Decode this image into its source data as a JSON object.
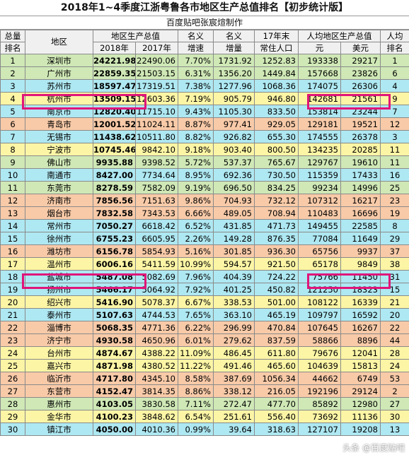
{
  "title": "2018年1~4季度江浙粤鲁各市地区生产总值排名【初步统计版】",
  "subtitle": "百度贴吧张宸煊制作",
  "headers": {
    "rank_line1": "总量",
    "rank_line2": "排名",
    "region": "地区",
    "gdp_group": "地区生产总值",
    "gdp_2018": "2018年",
    "gdp_2017": "2017年",
    "nominal_growth_1": "名义",
    "nominal_growth_2": "增速",
    "nominal_increase_1": "名义",
    "nominal_increase_2": "增量",
    "pop_1": "17年末",
    "pop_2": "常住人口",
    "per_capita_group": "人均地区生产总值",
    "per_capita_yuan": "元",
    "per_capita_usd": "美元",
    "per_capita_rank_1": "人均",
    "per_capita_rank_2": "排名"
  },
  "row_colors": {
    "cyan": "#aee8f2",
    "green": "#cfe8b6",
    "orange": "#f8caa8",
    "yellow": "#fbf5a5"
  },
  "rows": [
    {
      "rank": "1",
      "city": "深圳市",
      "g18": "24221.98",
      "g17": "22490.06",
      "growth": "7.70%",
      "inc": "1731.92",
      "pop": "1252.83",
      "pcy": "193338",
      "pcu": "29217",
      "pcr": "1",
      "color": "green"
    },
    {
      "rank": "2",
      "city": "广州市",
      "g18": "22859.35",
      "g17": "21503.15",
      "growth": "6.31%",
      "inc": "1356.20",
      "pop": "1449.84",
      "pcy": "157668",
      "pcu": "23826",
      "pcr": "6",
      "color": "green"
    },
    {
      "rank": "3",
      "city": "苏州市",
      "g18": "18597.47",
      "g17": "17319.51",
      "growth": "7.38%",
      "inc": "1277.96",
      "pop": "1068.36",
      "pcy": "174075",
      "pcu": "26306",
      "pcr": "4",
      "color": "cyan"
    },
    {
      "rank": "4",
      "city": "杭州市",
      "g18": "13509.15",
      "g17": "12603.36",
      "growth": "7.19%",
      "inc": "905.79",
      "pop": "946.80",
      "pcy": "142681",
      "pcu": "21561",
      "pcr": "9",
      "color": "yellow"
    },
    {
      "rank": "5",
      "city": "南京市",
      "g18": "12820.40",
      "g17": "11715.10",
      "growth": "9.43%",
      "inc": "1105.30",
      "pop": "833.50",
      "pcy": "153814",
      "pcu": "23244",
      "pcr": "7",
      "color": "cyan"
    },
    {
      "rank": "6",
      "city": "青岛市",
      "g18": "12001.52",
      "g17": "11024.11",
      "growth": "8.87%",
      "inc": "977.41",
      "pop": "929.05",
      "pcy": "129181",
      "pcu": "19521",
      "pcr": "12",
      "color": "orange"
    },
    {
      "rank": "7",
      "city": "无锡市",
      "g18": "11438.62",
      "g17": "10511.80",
      "growth": "8.82%",
      "inc": "926.82",
      "pop": "655.30",
      "pcy": "174555",
      "pcu": "26378",
      "pcr": "3",
      "color": "cyan"
    },
    {
      "rank": "8",
      "city": "宁波市",
      "g18": "10745.46",
      "g17": "9842.10",
      "growth": "9.18%",
      "inc": "903.40",
      "pop": "800.50",
      "pcy": "134235",
      "pcu": "20285",
      "pcr": "11",
      "color": "yellow"
    },
    {
      "rank": "9",
      "city": "佛山市",
      "g18": "9935.88",
      "g17": "9398.52",
      "growth": "5.72%",
      "inc": "537.37",
      "pop": "765.67",
      "pcy": "129767",
      "pcu": "19610",
      "pcr": "11",
      "color": "green"
    },
    {
      "rank": "10",
      "city": "南通市",
      "g18": "8427.00",
      "g17": "7734.64",
      "growth": "8.95%",
      "inc": "692.36",
      "pop": "730.50",
      "pcy": "115359",
      "pcu": "17433",
      "pcr": "16",
      "color": "cyan"
    },
    {
      "rank": "11",
      "city": "东莞市",
      "g18": "8278.59",
      "g17": "7582.09",
      "growth": "9.19%",
      "inc": "696.50",
      "pop": "834.25",
      "pcy": "99234",
      "pcu": "14996",
      "pcr": "25",
      "color": "green"
    },
    {
      "rank": "12",
      "city": "济南市",
      "g18": "7856.56",
      "g17": "7151.63",
      "growth": "9.86%",
      "inc": "704.93",
      "pop": "732.12",
      "pcy": "107312",
      "pcu": "16217",
      "pcr": "23",
      "color": "orange"
    },
    {
      "rank": "13",
      "city": "烟台市",
      "g18": "7832.58",
      "g17": "7343.53",
      "growth": "6.66%",
      "inc": "489.05",
      "pop": "708.94",
      "pcy": "110483",
      "pcu": "16696",
      "pcr": "19",
      "color": "orange"
    },
    {
      "rank": "14",
      "city": "常州市",
      "g18": "7050.27",
      "g17": "6618.42",
      "growth": "6.52%",
      "inc": "431.85",
      "pop": "471.73",
      "pcy": "149455",
      "pcu": "22585",
      "pcr": "8",
      "color": "cyan"
    },
    {
      "rank": "15",
      "city": "徐州市",
      "g18": "6755.23",
      "g17": "6605.95",
      "growth": "2.26%",
      "inc": "149.28",
      "pop": "876.35",
      "pcy": "77084",
      "pcu": "11649",
      "pcr": "29",
      "color": "cyan"
    },
    {
      "rank": "16",
      "city": "潍坊市",
      "g18": "6156.78",
      "g17": "5854.93",
      "growth": "5.16%",
      "inc": "301.85",
      "pop": "936.30",
      "pcy": "65756",
      "pcu": "9937",
      "pcr": "37",
      "color": "orange"
    },
    {
      "rank": "17",
      "city": "温州市",
      "g18": "6006.16",
      "g17": "5411.59",
      "growth": "10.99%",
      "inc": "594.57",
      "pop": "921.50",
      "pcy": "65178",
      "pcu": "9849",
      "pcr": "38",
      "color": "yellow"
    },
    {
      "rank": "18",
      "city": "盐城市",
      "g18": "5487.08",
      "g17": "5082.69",
      "growth": "7.96%",
      "inc": "404.39",
      "pop": "724.22",
      "pcy": "75766",
      "pcu": "11450",
      "pcr": "31",
      "color": "cyan"
    },
    {
      "rank": "19",
      "city": "扬州市",
      "g18": "5466.17",
      "g17": "5064.92",
      "growth": "7.92%",
      "inc": "401.25",
      "pop": "450.82",
      "pcy": "121250",
      "pcu": "18323",
      "pcr": "15",
      "color": "cyan"
    },
    {
      "rank": "20",
      "city": "绍兴市",
      "g18": "5416.90",
      "g17": "5078.37",
      "growth": "6.67%",
      "inc": "338.53",
      "pop": "501.00",
      "pcy": "108122",
      "pcu": "16339",
      "pcr": "21",
      "color": "yellow"
    },
    {
      "rank": "21",
      "city": "泰州市",
      "g18": "5107.63",
      "g17": "4744.53",
      "growth": "7.65%",
      "inc": "363.10",
      "pop": "465.19",
      "pcy": "109797",
      "pcu": "16592",
      "pcr": "20",
      "color": "cyan"
    },
    {
      "rank": "22",
      "city": "淄博市",
      "g18": "5068.35",
      "g17": "4771.36",
      "growth": "6.22%",
      "inc": "296.99",
      "pop": "470.84",
      "pcy": "107645",
      "pcu": "16267",
      "pcr": "22",
      "color": "orange"
    },
    {
      "rank": "23",
      "city": "济宁市",
      "g18": "4930.58",
      "g17": "4650.96",
      "growth": "6.01%",
      "inc": "279.62",
      "pop": "837.59",
      "pcy": "58866",
      "pcu": "8896",
      "pcr": "44",
      "color": "orange"
    },
    {
      "rank": "24",
      "city": "台州市",
      "g18": "4874.67",
      "g17": "4388.22",
      "growth": "11.09%",
      "inc": "486.45",
      "pop": "611.80",
      "pcy": "79676",
      "pcu": "12041",
      "pcr": "28",
      "color": "yellow"
    },
    {
      "rank": "25",
      "city": "嘉兴市",
      "g18": "4871.98",
      "g17": "4380.52",
      "growth": "11.22%",
      "inc": "491.46",
      "pop": "465.60",
      "pcy": "104639",
      "pcu": "15813",
      "pcr": "24",
      "color": "yellow"
    },
    {
      "rank": "26",
      "city": "临沂市",
      "g18": "4717.80",
      "g17": "4345.10",
      "growth": "8.58%",
      "inc": "387.69",
      "pop": "1056.34",
      "pcy": "44662",
      "pcu": "6749",
      "pcr": "53",
      "color": "orange"
    },
    {
      "rank": "27",
      "city": "东营市",
      "g18": "4152.47",
      "g17": "3814.35",
      "growth": "8.86%",
      "inc": "338.12",
      "pop": "216.05",
      "pcy": "192196",
      "pcu": "29124",
      "pcr": "2",
      "color": "orange"
    },
    {
      "rank": "28",
      "city": "惠州市",
      "g18": "4103.05",
      "g17": "3830.58",
      "growth": "7.11%",
      "inc": "272.47",
      "pop": "477.70",
      "pcy": "85892",
      "pcu": "12980",
      "pcr": "27",
      "color": "green"
    },
    {
      "rank": "29",
      "city": "金华市",
      "g18": "4100.23",
      "g17": "3848.62",
      "growth": "6.54%",
      "inc": "251.61",
      "pop": "556.40",
      "pcy": "73692",
      "pcu": "11136",
      "pcr": "30",
      "color": "yellow"
    },
    {
      "rank": "30",
      "city": "镇江市",
      "g18": "4050.00",
      "g17": "4010.36",
      "growth": "0.99%",
      "inc": "39.64",
      "pop": "318.63",
      "pcy": "127107",
      "pcu": "19208",
      "pcr": "13",
      "color": "cyan"
    }
  ],
  "watermark": "头条 @百度贴吧"
}
